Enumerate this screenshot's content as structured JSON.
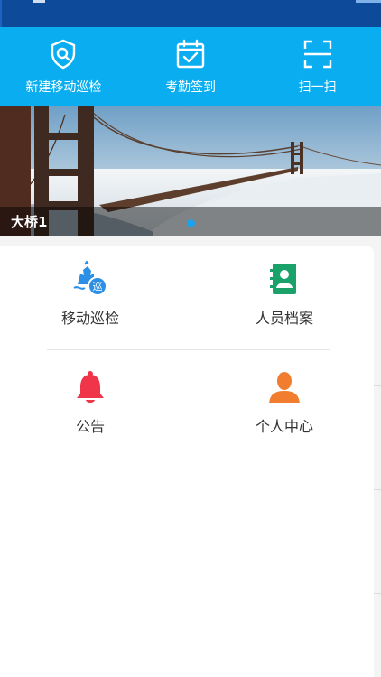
{
  "quick_actions": [
    {
      "label": "新建移动巡检",
      "icon": "shield-search-icon"
    },
    {
      "label": "考勤签到",
      "icon": "calendar-check-icon"
    },
    {
      "label": "扫一扫",
      "icon": "scan-icon"
    }
  ],
  "banner": {
    "caption": "大桥1"
  },
  "grid": [
    {
      "label": "移动巡检",
      "icon": "patrol-icon",
      "badge": "巡",
      "color": "#2b8fe6"
    },
    {
      "label": "人员档案",
      "icon": "contacts-book-icon",
      "color": "#1aa26a"
    },
    {
      "label": "公告",
      "icon": "bell-icon",
      "color": "#f0344a"
    },
    {
      "label": "个人中心",
      "icon": "person-icon",
      "color": "#f07e2e"
    }
  ],
  "colors": {
    "status_bar": "#0d4a9a",
    "quick_bar": "#0aaef0",
    "banner_dot": "#1aa3f0"
  }
}
